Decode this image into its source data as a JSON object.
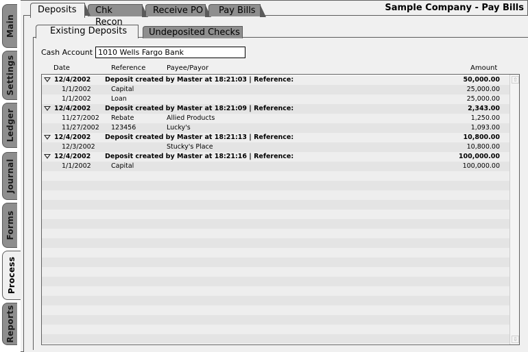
{
  "window": {
    "title": "Sample Company - Pay Bills"
  },
  "side_tabs": [
    "Main",
    "Settings",
    "Ledger",
    "Journal",
    "Forms",
    "Process",
    "Reports"
  ],
  "side_active": "Process",
  "top_tabs": [
    "Deposits",
    "Chk Recon",
    "Receive PO",
    "Pay Bills"
  ],
  "top_active": "Deposits",
  "sub_tabs": [
    "Existing Deposits",
    "Undeposited Checks"
  ],
  "sub_active": "Existing Deposits",
  "cash_account": {
    "label": "Cash Account",
    "value": "1010 Wells Fargo Bank"
  },
  "columns": {
    "date": "Date",
    "reference": "Reference",
    "payee": "Payee/Payor",
    "amount": "Amount"
  },
  "groups": [
    {
      "date": "12/4/2002",
      "desc": "Deposit created by Master at 18:21:03 | Reference:",
      "amount": "50,000.00",
      "items": [
        {
          "date": "1/1/2002",
          "reference": "Capital",
          "payee": "",
          "amount": "25,000.00"
        },
        {
          "date": "1/1/2002",
          "reference": "Loan",
          "payee": "",
          "amount": "25,000.00"
        }
      ]
    },
    {
      "date": "12/4/2002",
      "desc": "Deposit created by Master at 18:21:09 | Reference:",
      "amount": "2,343.00",
      "items": [
        {
          "date": "11/27/2002",
          "reference": "Rebate",
          "payee": "Allied Products",
          "amount": "1,250.00"
        },
        {
          "date": "11/27/2002",
          "reference": "123456",
          "payee": "Lucky's",
          "amount": "1,093.00"
        }
      ]
    },
    {
      "date": "12/4/2002",
      "desc": "Deposit created by Master at 18:21:13 | Reference:",
      "amount": "10,800.00",
      "items": [
        {
          "date": "12/3/2002",
          "reference": "",
          "payee": "Stucky's Place",
          "amount": "10,800.00"
        }
      ]
    },
    {
      "date": "12/4/2002",
      "desc": "Deposit created by Master at 18:21:16 | Reference:",
      "amount": "100,000.00",
      "items": [
        {
          "date": "1/1/2002",
          "reference": "Capital",
          "payee": "",
          "amount": "100,000.00"
        }
      ]
    }
  ]
}
